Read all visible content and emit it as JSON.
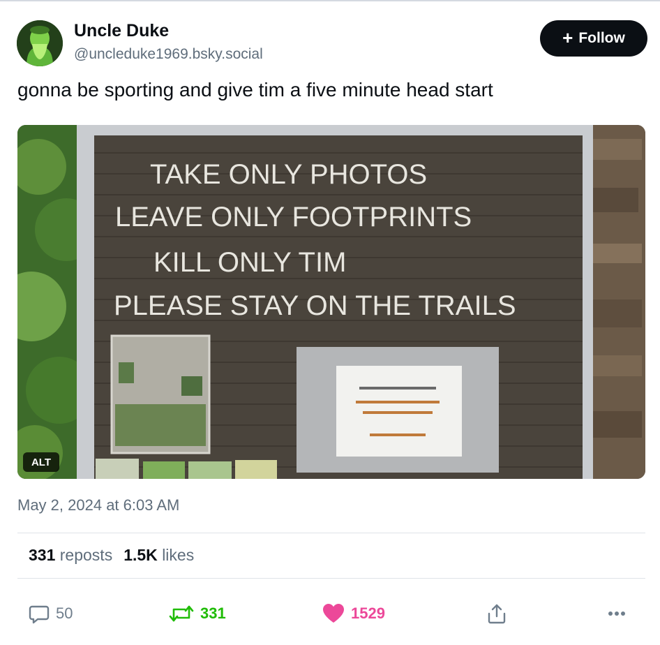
{
  "author": {
    "name": "Uncle Duke",
    "handle": "@uncleduke1969.bsky.social"
  },
  "follow_button": {
    "label": "Follow",
    "icon": "plus-icon"
  },
  "post": {
    "text": "gonna be sporting and give tim a five minute head start",
    "timestamp": "May 2, 2024 at 6:03 AM"
  },
  "image": {
    "alt_label": "ALT",
    "sign_lines": [
      "TAKE   ONLY  PHOTOS",
      "LEAVE ONLY  FOOTPRINTS",
      "KILL  ONLY  TIM",
      "PLEASE STAY ON THE TRAILS"
    ]
  },
  "stats": {
    "reposts_count": "331",
    "reposts_label": "reposts",
    "likes_count": "1.5K",
    "likes_label": "likes"
  },
  "actions": {
    "reply_count": "50",
    "repost_count": "331",
    "like_count": "1529",
    "reply_color": "#6f7e8c",
    "repost_color": "#20bc07",
    "like_color": "#ec4899"
  }
}
